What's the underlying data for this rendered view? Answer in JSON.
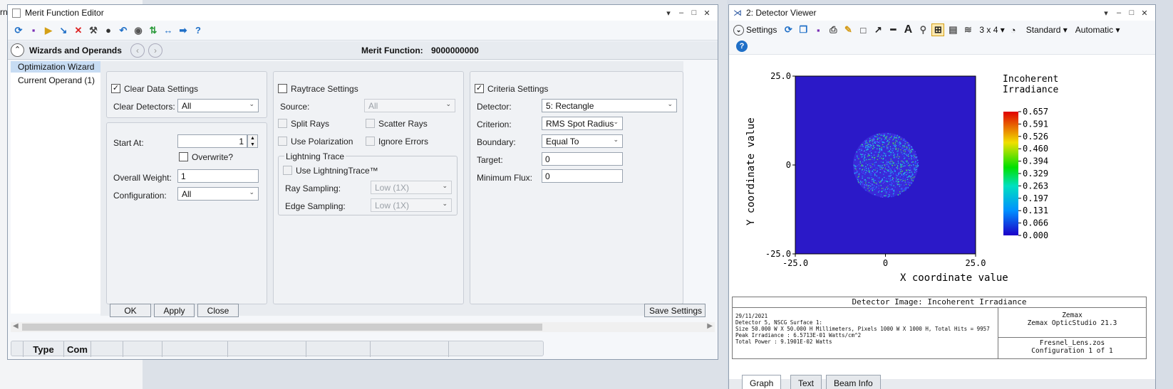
{
  "left_edge_text": "rn",
  "mfe": {
    "title": "Merit Function Editor",
    "controls": [
      "▾",
      "–",
      "□",
      "✕"
    ],
    "wizards_label": "Wizards and Operands",
    "merit_label": "Merit Function:",
    "merit_value": "9000000000",
    "tree": [
      "Optimization Wizard",
      "Current Operand (1)"
    ],
    "clear": {
      "title": "Clear Data Settings",
      "detectors_label": "Clear Detectors:",
      "detectors_value": "All",
      "start_label": "Start At:",
      "start_value": "1",
      "overwrite_label": "Overwrite?",
      "weight_label": "Overall Weight:",
      "weight_value": "1",
      "config_label": "Configuration:",
      "config_value": "All"
    },
    "raytrace": {
      "title": "Raytrace Settings",
      "source_label": "Source:",
      "source_value": "All",
      "split_rays": "Split Rays",
      "scatter_rays": "Scatter Rays",
      "use_polarization": "Use Polarization",
      "ignore_errors": "Ignore Errors",
      "lightning_title": "Lightning Trace",
      "use_lightning": "Use LightningTrace™",
      "ray_sampling_label": "Ray Sampling:",
      "ray_sampling_value": "Low (1X)",
      "edge_sampling_label": "Edge Sampling:",
      "edge_sampling_value": "Low (1X)"
    },
    "criteria": {
      "title": "Criteria Settings",
      "detector_label": "Detector:",
      "detector_value": "5: Rectangle",
      "criterion_label": "Criterion:",
      "criterion_value": "RMS Spot Radius",
      "boundary_label": "Boundary:",
      "boundary_value": "Equal To",
      "target_label": "Target:",
      "target_value": "0",
      "min_flux_label": "Minimum Flux:",
      "min_flux_value": "0"
    },
    "buttons": {
      "ok": "OK",
      "apply": "Apply",
      "close": "Close",
      "save": "Save Settings"
    },
    "columns": [
      "Type",
      "Com"
    ]
  },
  "dv": {
    "title": "2: Detector Viewer",
    "controls": [
      "▾",
      "–",
      "□",
      "✕"
    ],
    "settings_label": "Settings",
    "layout_label": "3 x 4",
    "standard_label": "Standard",
    "automatic_label": "Automatic",
    "tabs": [
      "Graph",
      "Text",
      "Beam Info"
    ],
    "footer": {
      "heading": "Detector Image: Incoherent Irradiance",
      "date": "29/11/2021",
      "line1": "Detector 5, NSCG Surface 1:",
      "line2": "Size 50.000 W X 50.000 H Millimeters, Pixels 1000 W X 1000 H, Total Hits = 9957",
      "line3": "Peak Irradiance : 6.5713E-01 Watts/cm^2",
      "line4": "Total Power    : 9.1901E-02 Watts",
      "company": "Zemax",
      "product": "Zemax OpticStudio 21.3",
      "file": "Fresnel_Lens.zos",
      "config": "Configuration 1 of 1"
    }
  },
  "chart_data": {
    "type": "heatmap",
    "title": "",
    "xlabel": "X coordinate value",
    "ylabel": "Y coordinate value",
    "xlim": [
      -25.0,
      25.0
    ],
    "ylim": [
      -25.0,
      25.0
    ],
    "x_ticks": [
      "-25.0",
      "0",
      "25.0"
    ],
    "y_ticks": [
      "25.0",
      "0",
      "-25.0"
    ],
    "colorbar_title": "Incoherent Irradiance",
    "colorbar_ticks": [
      "0.657",
      "0.591",
      "0.526",
      "0.460",
      "0.394",
      "0.329",
      "0.263",
      "0.197",
      "0.131",
      "0.066",
      "0.000"
    ],
    "peak": 0.657,
    "background_color": "#2b19c8",
    "spot": {
      "center_x": 0,
      "center_y": 0,
      "radius": 9
    }
  }
}
